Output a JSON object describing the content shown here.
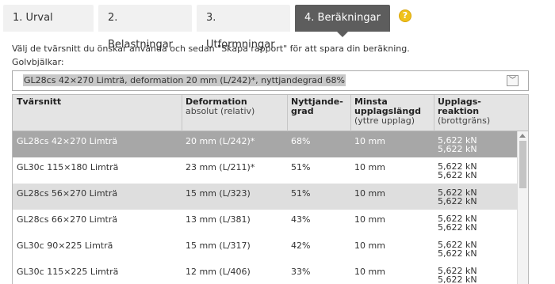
{
  "tabs": [
    {
      "label": "1. Urval",
      "active": false
    },
    {
      "label": "2. Belastningar",
      "active": false
    },
    {
      "label": "3. Utformningar",
      "active": false
    },
    {
      "label": "4. Beräkningar",
      "active": true
    }
  ],
  "help_icon": "question-icon",
  "help_symbol": "?",
  "intro_text": "Välj de tvärsnitt du önskar använda och sedan \"Skapa rapport\" för att spara din beräkning.",
  "subject_label": "Golvbjälkar:",
  "select": {
    "value": "GL28cs 42×270 Limträ, deformation 20 mm (L/242)*, nyttjandegrad 68%",
    "caret": "﹀"
  },
  "table": {
    "headers": {
      "section": "Tvärsnitt",
      "deformation": "Deformation",
      "deformation_sub": "absolut (relativ)",
      "utilization_1": "Nyttjande-",
      "utilization_2": "grad",
      "support_1": "Minsta",
      "support_2": "upplagslängd",
      "support_sub": "(yttre upplag)",
      "reaction_1": "Upplags-",
      "reaction_2": "reaktion",
      "reaction_sub": "(brottgräns)"
    },
    "rows": [
      {
        "section": "GL28cs 42×270 Limträ",
        "deformation": "20 mm (L/242)*",
        "utilization": "68%",
        "support": "10 mm",
        "reaction_1": "5,622 kN",
        "reaction_2": "5,622 kN"
      },
      {
        "section": "GL30c 115×180 Limträ",
        "deformation": "23 mm (L/211)*",
        "utilization": "51%",
        "support": "10 mm",
        "reaction_1": "5,622 kN",
        "reaction_2": "5,622 kN"
      },
      {
        "section": "GL28cs 56×270 Limträ",
        "deformation": "15 mm (L/323)",
        "utilization": "51%",
        "support": "10 mm",
        "reaction_1": "5,622 kN",
        "reaction_2": "5,622 kN"
      },
      {
        "section": "GL28cs 66×270 Limträ",
        "deformation": "13 mm (L/381)",
        "utilization": "43%",
        "support": "10 mm",
        "reaction_1": "5,622 kN",
        "reaction_2": "5,622 kN"
      },
      {
        "section": "GL30c 90×225 Limträ",
        "deformation": "15 mm (L/317)",
        "utilization": "42%",
        "support": "10 mm",
        "reaction_1": "5,622 kN",
        "reaction_2": "5,622 kN"
      },
      {
        "section": "GL30c 115×225 Limträ",
        "deformation": "12 mm (L/406)",
        "utilization": "33%",
        "support": "10 mm",
        "reaction_1": "5,622 kN",
        "reaction_2": "5,622 kN"
      }
    ]
  },
  "colors": {
    "active_tab": "#5d5d5d",
    "selected_row": "#a7a7a7",
    "alt_row": "#dedede",
    "help_icon": "#f0c21a"
  }
}
